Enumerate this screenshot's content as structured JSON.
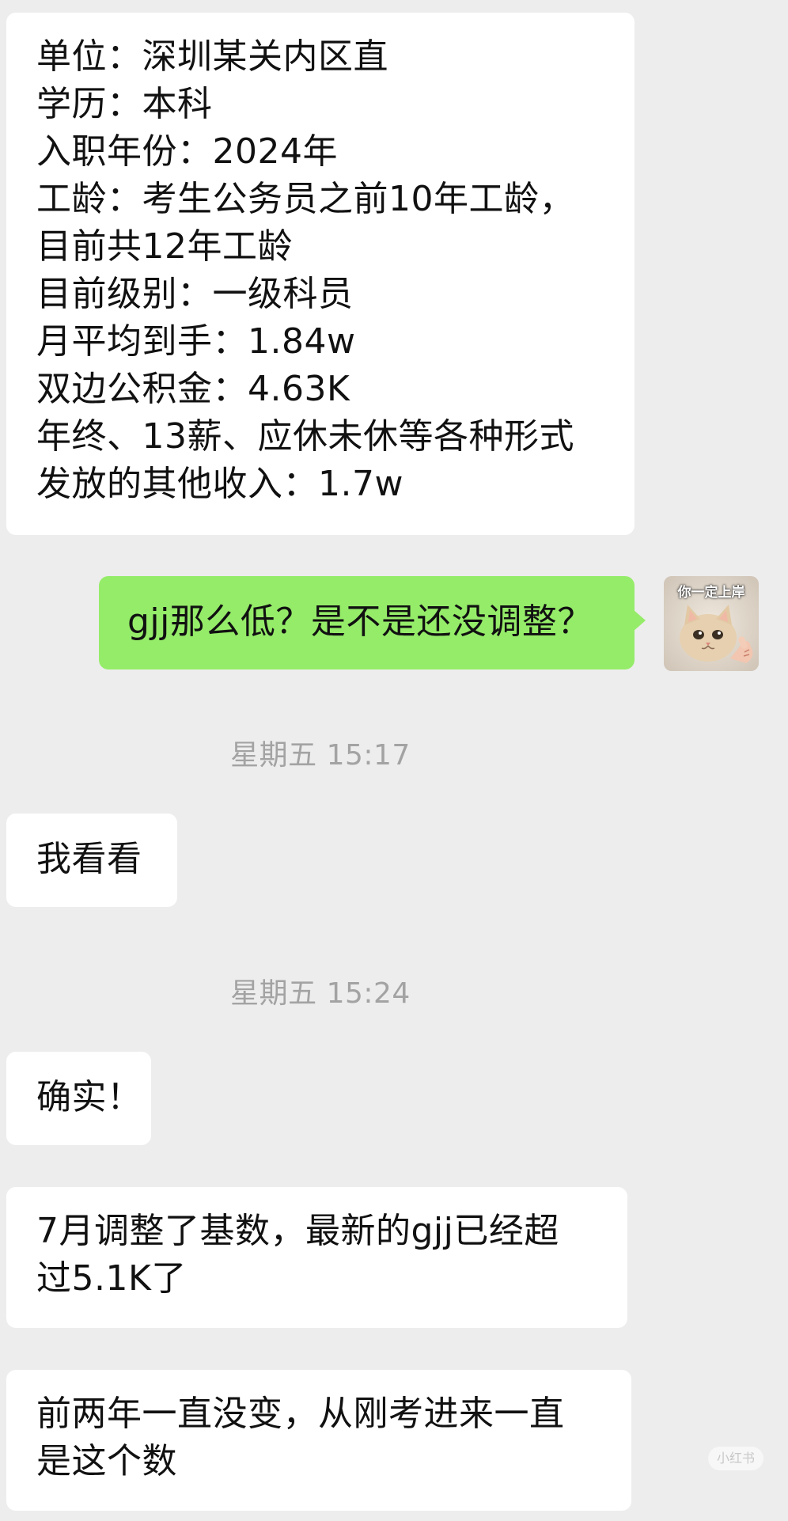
{
  "messages": [
    {
      "lines": [
        "单位：深圳某关内区直",
        "学历：本科",
        "入职年份：2024年",
        "工龄：考生公务员之前10年工龄，",
        "目前共12年工龄",
        "目前级别：一级科员",
        "月平均到手：1.84w",
        "双边公积金：4.63K",
        "年终、13薪、应休未休等各种形式",
        "发放的其他收入：1.7w"
      ]
    },
    {
      "lines": [
        "gjj那么低？是不是还没调整？"
      ]
    },
    {
      "lines": [
        "我看看"
      ]
    },
    {
      "lines": [
        "确实！"
      ]
    },
    {
      "lines": [
        "7月调整了基数，最新的gjj已经超",
        "过5.1K了"
      ]
    },
    {
      "lines": [
        "前两年一直没变，从刚考进来一直",
        "是这个数"
      ]
    }
  ],
  "timestamps": [
    "星期五 15:17",
    "星期五 15:24"
  ],
  "avatar": {
    "caption": "你一定上岸",
    "icon": "cat-pointing-avatar"
  },
  "watermark": "小红书",
  "colors": {
    "background": "#ededed",
    "incoming_bubble": "#ffffff",
    "outgoing_bubble": "#95ec69",
    "timestamp_text": "#a3a3a3"
  }
}
